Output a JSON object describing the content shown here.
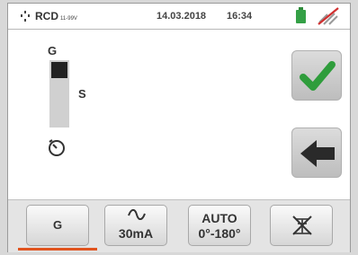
{
  "header": {
    "title": "RCD",
    "subtitle": "11-99V",
    "date": "14.03.2018",
    "time": "16:34",
    "battery_color": "#34a046",
    "status_icons": [
      "test-icon",
      "battery-icon",
      "no-connection-icon"
    ]
  },
  "selector": {
    "option_top": "G",
    "option_bottom": "S",
    "selected": "G",
    "timer_icon": "timer-icon"
  },
  "actions": {
    "confirm_icon": "check-icon",
    "confirm_color": "#2f9d3c",
    "back_icon": "arrow-left-icon"
  },
  "bottom": {
    "type_label": "G",
    "current_label": "30mA",
    "phase_line1": "AUTO",
    "phase_line2": "0°-180°",
    "touch_icon": "no-touch-icon",
    "active_underline_color": "#e0541f"
  }
}
